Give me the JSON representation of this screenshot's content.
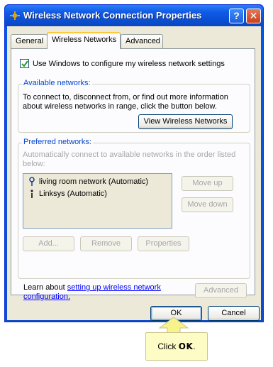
{
  "window": {
    "title": "Wireless Network Connection Properties",
    "help_label": "?",
    "close_label": "✕"
  },
  "tabs": [
    {
      "label": "General"
    },
    {
      "label": "Wireless Networks"
    },
    {
      "label": "Advanced"
    }
  ],
  "wireless_tab": {
    "use_windows_label": "Use Windows to configure my wireless network settings",
    "use_windows_checked": true,
    "available": {
      "legend": "Available networks:",
      "line1": "To connect to, disconnect from, or find out more information",
      "line2": "about wireless networks in range, click the button below.",
      "view_button": "View Wireless Networks"
    },
    "preferred": {
      "legend": "Preferred networks:",
      "line1": "Automatically connect to available networks in the order listed",
      "line2": "below:",
      "networks": [
        {
          "label": "living room network (Automatic)",
          "icon": "wireless-antenna-icon"
        },
        {
          "label": "Linksys (Automatic)",
          "icon": "wireless-antenna-icon"
        }
      ],
      "move_up": "Move up",
      "move_down": "Move down",
      "add": "Add...",
      "remove": "Remove",
      "properties": "Properties"
    },
    "learn_prefix": "Learn about ",
    "learn_link1": "setting up wireless network",
    "learn_link2": "configuration.",
    "advanced_button": "Advanced"
  },
  "footer": {
    "ok": "OK",
    "cancel": "Cancel"
  },
  "callout": {
    "prefix": "Click ",
    "emph": "OK",
    "suffix": "."
  },
  "colors": {
    "titlebar": "#0a4fd4",
    "dialog_bg": "#ece9d8",
    "callout_bg": "#fefcc5",
    "callout_arrow": "#f7f28a"
  }
}
